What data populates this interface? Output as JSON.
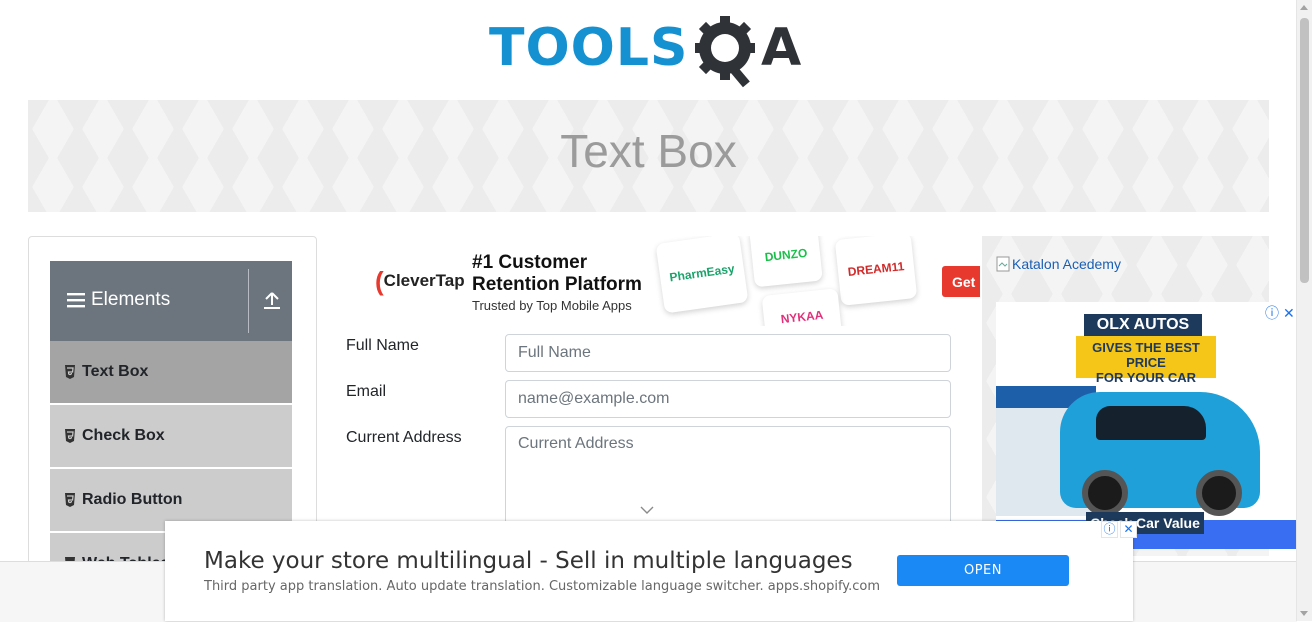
{
  "logo": {
    "text_tools": "TOOLS",
    "text_q": "Q",
    "text_a": "A",
    "accent": "#1591d1"
  },
  "banner": {
    "title": "Text Box"
  },
  "sidebar": {
    "group_title": "Elements",
    "items": [
      {
        "label": "Text Box",
        "active": true
      },
      {
        "label": "Check Box",
        "active": false
      },
      {
        "label": "Radio Button",
        "active": false
      },
      {
        "label": "Web Tables",
        "active": false
      }
    ]
  },
  "top_ad": {
    "brand": "CleverTap",
    "headline_1": "#1 Customer",
    "headline_2": "Retention Platform",
    "subline": "Trusted by Top Mobile Apps",
    "cards": [
      "PharmEasy",
      "DUNZO",
      "DREAM11",
      "NYKAA"
    ],
    "cta": "Get"
  },
  "form": {
    "full_name_label": "Full Name",
    "full_name_placeholder": "Full Name",
    "email_label": "Email",
    "email_placeholder": "name@example.com",
    "address_label": "Current Address",
    "address_placeholder": "Current Address"
  },
  "right_ad": {
    "katalon_alt": "Katalon Acedemy",
    "olx_brand": "OLX AUTOS",
    "olx_tag_1": "GIVES THE BEST PRICE",
    "olx_tag_2": "FOR YOUR CAR",
    "olx_cta": "Check Car Value"
  },
  "bottom_ad": {
    "headline": "Make your store multilingual - Sell in multiple languages",
    "subline": "Third party app translation. Auto update translation. Customizable language switcher. apps.shopify.com",
    "button": "OPEN"
  }
}
